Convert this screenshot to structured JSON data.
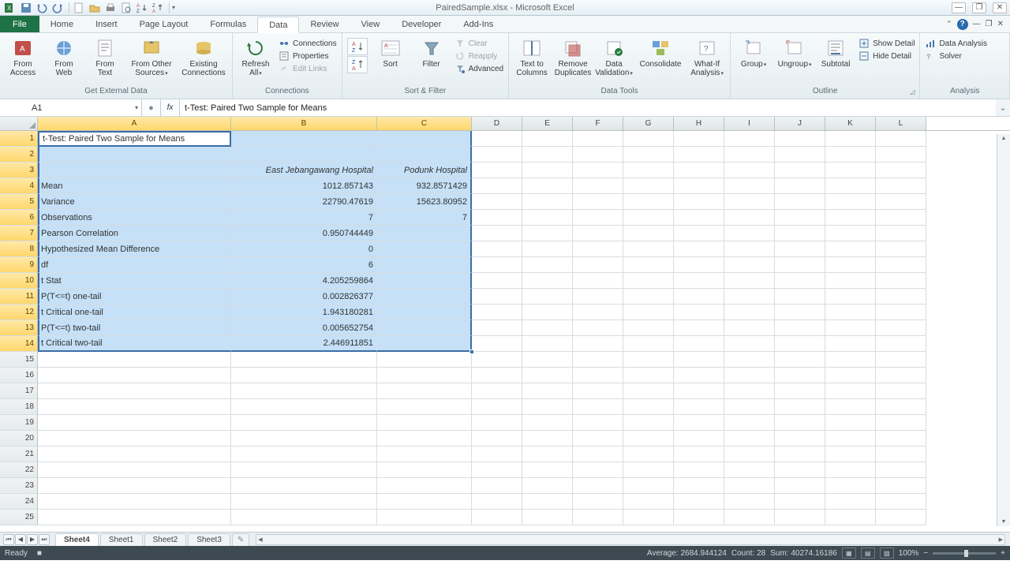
{
  "window": {
    "title": "PairedSample.xlsx - Microsoft Excel"
  },
  "tabs": {
    "file": "File",
    "home": "Home",
    "insert": "Insert",
    "pagelayout": "Page Layout",
    "formulas": "Formulas",
    "data": "Data",
    "review": "Review",
    "view": "View",
    "developer": "Developer",
    "addins": "Add-Ins"
  },
  "ribbonGroups": {
    "getExternal": {
      "label": "Get External Data",
      "access": "From\nAccess",
      "web": "From\nWeb",
      "text": "From\nText",
      "other": "From Other\nSources",
      "existing": "Existing\nConnections"
    },
    "connections": {
      "label": "Connections",
      "refresh": "Refresh\nAll",
      "conns": "Connections",
      "props": "Properties",
      "editlinks": "Edit Links"
    },
    "sortFilter": {
      "label": "Sort & Filter",
      "sort": "Sort",
      "filter": "Filter",
      "clear": "Clear",
      "reapply": "Reapply",
      "advanced": "Advanced"
    },
    "dataTools": {
      "label": "Data Tools",
      "texttocol": "Text to\nColumns",
      "removedup": "Remove\nDuplicates",
      "dataval": "Data\nValidation",
      "consolidate": "Consolidate",
      "whatif": "What-If\nAnalysis"
    },
    "outline": {
      "label": "Outline",
      "group": "Group",
      "ungroup": "Ungroup",
      "subtotal": "Subtotal",
      "showdetail": "Show Detail",
      "hidedetail": "Hide Detail"
    },
    "analysis": {
      "label": "Analysis",
      "dataanalysis": "Data Analysis",
      "solver": "Solver"
    }
  },
  "nameBox": "A1",
  "formulaBar": "t-Test: Paired Two Sample for Means",
  "columns": [
    "A",
    "B",
    "C",
    "D",
    "E",
    "F",
    "G",
    "H",
    "I",
    "J",
    "K",
    "L"
  ],
  "selectedCols": [
    "A",
    "B",
    "C"
  ],
  "rowCount": 25,
  "selectedRows": [
    1,
    2,
    3,
    4,
    5,
    6,
    7,
    8,
    9,
    10,
    11,
    12,
    13,
    14
  ],
  "sheet": {
    "a1": "t-Test: Paired Two Sample for Means",
    "b3": "East Jebangawang Hospital",
    "c3": "Podunk Hospital",
    "rows": [
      {
        "a": "Mean",
        "b": "1012.857143",
        "c": "932.8571429"
      },
      {
        "a": "Variance",
        "b": "22790.47619",
        "c": "15623.80952"
      },
      {
        "a": "Observations",
        "b": "7",
        "c": "7"
      },
      {
        "a": "Pearson Correlation",
        "b": "0.950744449",
        "c": ""
      },
      {
        "a": "Hypothesized Mean Difference",
        "b": "0",
        "c": ""
      },
      {
        "a": "df",
        "b": "6",
        "c": ""
      },
      {
        "a": "t Stat",
        "b": "4.205259864",
        "c": ""
      },
      {
        "a": "P(T<=t) one-tail",
        "b": "0.002826377",
        "c": ""
      },
      {
        "a": "t Critical one-tail",
        "b": "1.943180281",
        "c": ""
      },
      {
        "a": "P(T<=t) two-tail",
        "b": "0.005652754",
        "c": ""
      },
      {
        "a": "t Critical two-tail",
        "b": "2.446911851",
        "c": ""
      }
    ]
  },
  "sheets": [
    "Sheet4",
    "Sheet1",
    "Sheet2",
    "Sheet3"
  ],
  "activeSheet": "Sheet4",
  "status": {
    "ready": "Ready",
    "average": "Average: 2684.944124",
    "count": "Count: 28",
    "sum": "Sum: 40274.16186",
    "zoom": "100%"
  }
}
